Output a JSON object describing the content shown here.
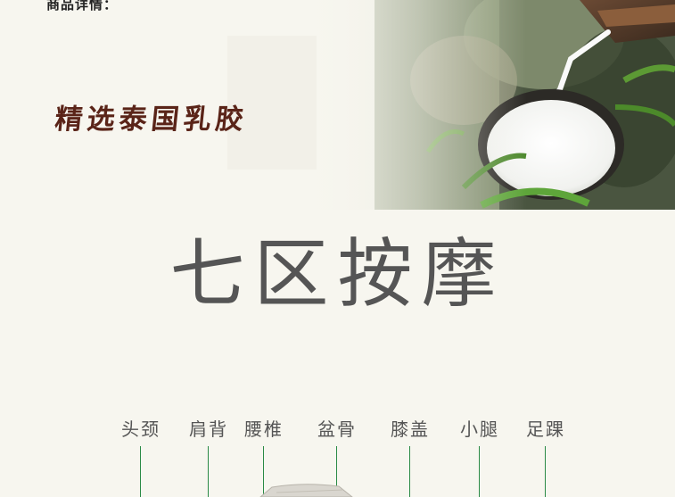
{
  "header": {
    "section_label": "商品详情：",
    "banner_title": "精选泰国乳胶"
  },
  "main": {
    "headline": "七区按摩"
  },
  "zones": [
    {
      "label": "头颈"
    },
    {
      "label": "肩背"
    },
    {
      "label": "腰椎"
    },
    {
      "label": "盆骨"
    },
    {
      "label": "膝盖"
    },
    {
      "label": "小腿"
    },
    {
      "label": "足踝"
    }
  ],
  "colors": {
    "background": "#f7f6ef",
    "banner_title": "#5a2418",
    "headline": "#555555",
    "zone_line": "#2a8a45"
  },
  "images": {
    "banner_photo": "latex-tapping-photo",
    "mattress_photo": "mattress-corner-photo"
  }
}
